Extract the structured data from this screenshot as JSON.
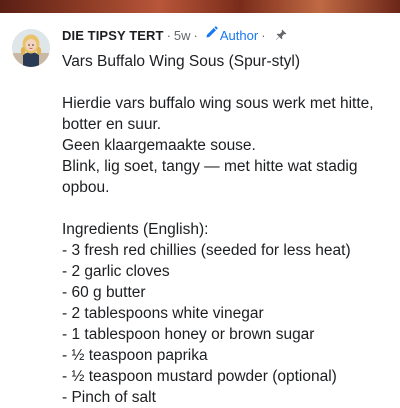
{
  "post": {
    "author": "DIE TIPSY TERT",
    "time": "5w",
    "separator": "·",
    "badge_label": "Author",
    "icons": {
      "edit": "pencil-icon",
      "pin": "pin-icon"
    },
    "colors": {
      "badge": "#1877f2",
      "meta": "#65676b",
      "text": "#1c1e21"
    }
  },
  "content": {
    "title": "Vars Buffalo Wing Sous (Spur-styl)",
    "intro_1": "Hierdie vars buffalo wing sous werk met hitte, botter en suur.",
    "intro_2": "Geen klaargemaakte souse.",
    "intro_3": "Blink, lig soet, tangy — met hitte wat stadig opbou.",
    "ingredients_heading": "Ingredients (English):",
    "ingredients": [
      "- 3 fresh red chillies (seeded for less heat)",
      "- 2 garlic cloves",
      "- 60 g butter",
      "- 2 tablespoons white vinegar",
      "- 1 tablespoon honey or brown sugar",
      "- ½ teaspoon paprika",
      "- ½ teaspoon mustard powder (optional)",
      "- Pinch of salt"
    ]
  }
}
